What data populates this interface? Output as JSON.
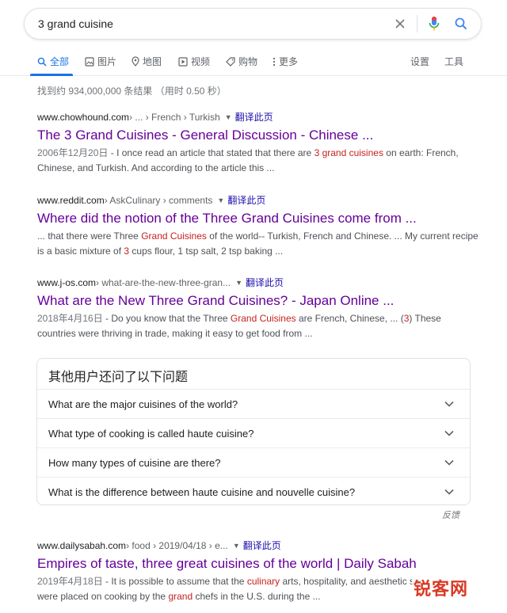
{
  "search": {
    "query": "3 grand cuisine"
  },
  "tabs": [
    {
      "label": "全部",
      "icon": "search-icon"
    },
    {
      "label": "图片",
      "icon": "image-icon"
    },
    {
      "label": "地图",
      "icon": "map-pin-icon"
    },
    {
      "label": "视频",
      "icon": "video-icon"
    },
    {
      "label": "购物",
      "icon": "tag-icon"
    },
    {
      "label": "更多",
      "icon": "more-vert-icon"
    }
  ],
  "tools": {
    "settings": "设置",
    "tools": "工具"
  },
  "stats": "找到约 934,000,000 条结果 （用时 0.50 秒）",
  "results": [
    {
      "domain": "www.chowhound.com",
      "path": " › ... › French › Turkish",
      "translate": "翻译此页",
      "title": "The 3 Grand Cuisines - General Discussion - Chinese ...",
      "date": "2006年12月20日",
      "s1": " - I once read an article that stated that there are ",
      "h1": "3 grand cuisines",
      "s2": " on earth: French, Chinese, and Turkish. And according to the article this ..."
    },
    {
      "domain": "www.reddit.com",
      "path": " › AskCulinary › comments",
      "translate": "翻译此页",
      "title": "Where did the notion of the Three Grand Cuisines come from ...",
      "s1": "... that there were Three ",
      "h1": "Grand Cuisines",
      "s2": " of the world-- Turkish, French and Chinese. ... My current recipe is a basic mixture of ",
      "h2": "3",
      "s3": " cups flour, 1 tsp salt, 2 tsp baking ..."
    },
    {
      "domain": "www.j-os.com",
      "path": " › what-are-the-new-three-gran...",
      "translate": "翻译此页",
      "title": "What are the New Three Grand Cuisines? - Japan Online ...",
      "date": "2018年4月16日",
      "s1": " - Do you know that the Three ",
      "h1": "Grand Cuisines",
      "s2": " are French, Chinese, ... (",
      "h2": "3",
      "s3": ") These countries were thriving in trade, making it easy to get food from ..."
    },
    {
      "domain": "www.dailysabah.com",
      "path": " › food › 2019/04/18 › e...",
      "translate": "翻译此页",
      "title": "Empires of taste, three great cuisines of the world | Daily Sabah",
      "date": "2019年4月18日",
      "s1": " - It is possible to assume that the ",
      "h1": "culinary",
      "s2": " arts, hospitality, and aesthetic se",
      "s3": "were placed on cooking by the ",
      "h2": "grand",
      "s4": " chefs in the U.S. during the ..."
    }
  ],
  "paa": {
    "title": "其他用户还问了以下问题",
    "questions": [
      "What are the major cuisines of the world?",
      "What type of cooking is called haute cuisine?",
      "How many types of cuisine are there?",
      "What is the difference between haute cuisine and nouvelle cuisine?"
    ],
    "feedback": "反馈"
  },
  "watermark": "锐客网",
  "colors": {
    "accent": "#1a73e8",
    "visited_title": "#660099",
    "highlight": "#c5221f",
    "mic_red": "#ea4335"
  }
}
